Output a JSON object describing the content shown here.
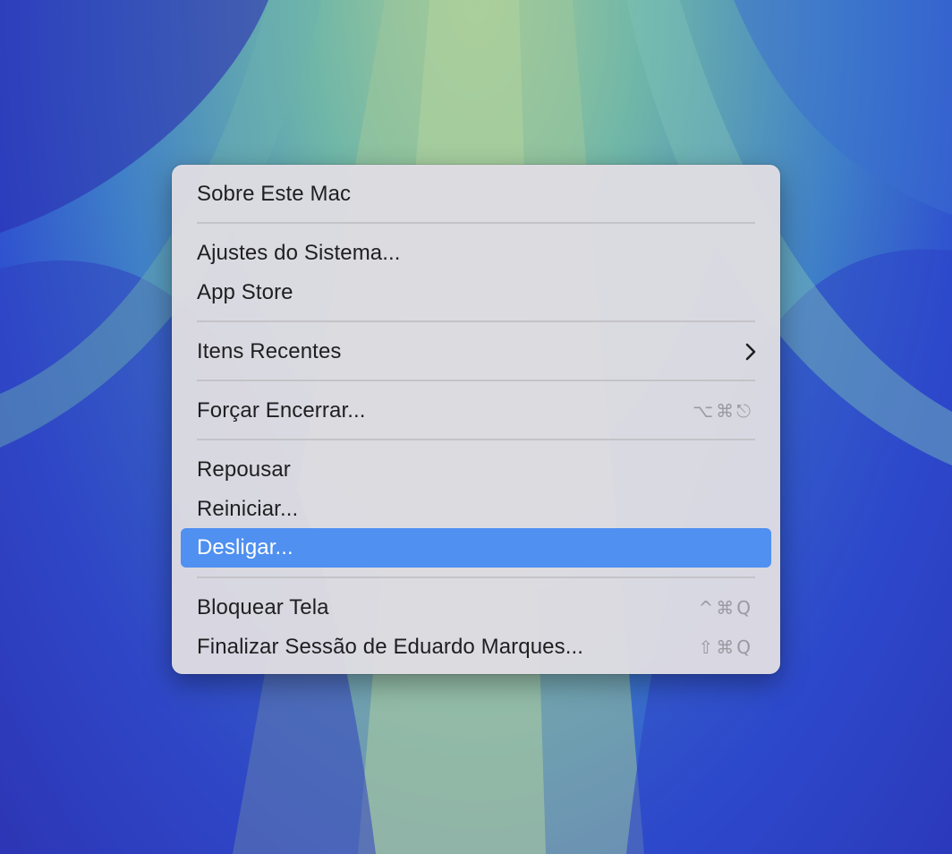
{
  "menu": {
    "items": [
      {
        "label": "Sobre Este Mac"
      },
      {
        "label": "Ajustes do Sistema..."
      },
      {
        "label": "App Store"
      },
      {
        "label": "Itens Recentes",
        "submenu": "chevron-right-icon"
      },
      {
        "label": "Forçar Encerrar...",
        "shortcut": "⌥⌘⎋"
      },
      {
        "label": "Repousar"
      },
      {
        "label": "Reiniciar..."
      },
      {
        "label": "Desligar...",
        "selected": true
      },
      {
        "label": "Bloquear Tela",
        "shortcut": "^⌘Q"
      },
      {
        "label": "Finalizar Sessão de Eduardo Marques...",
        "shortcut": "⇧⌘Q"
      }
    ]
  },
  "colors": {
    "highlight": "#4f90f0",
    "menu_background": "#dedce2",
    "text": "#1f1f21",
    "shortcut_text": "#9a9aa0"
  }
}
